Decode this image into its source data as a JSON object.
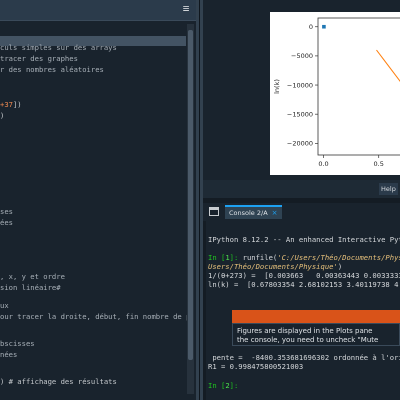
{
  "editor": {
    "lines": [
      {
        "text": "culs simples sur des arrays",
        "kind": "comment"
      },
      {
        "text": "tracer des graphes",
        "kind": "comment"
      },
      {
        "text": "r des nombres aléatoires",
        "kind": "comment"
      },
      {
        "text": ""
      },
      {
        "text": ""
      },
      {
        "pre": "",
        "num": "+37",
        "post": "])"
      },
      {
        "text": ")"
      },
      {
        "text": "ses",
        "kind": "comment"
      },
      {
        "text": "ées",
        "kind": "comment"
      },
      {
        "text": ", x, y et ordre",
        "kind": "comment"
      },
      {
        "text": "sion linéaire#",
        "kind": "comment"
      },
      {
        "text": "ux",
        "kind": "comment"
      },
      {
        "text": "our tracer la droite, début, fin nombre de p",
        "kind": "comment"
      },
      {
        "text": "bscisses",
        "kind": "comment"
      },
      {
        "text": "nées",
        "kind": "comment"
      },
      {
        "text": ") # affichage des résultats"
      }
    ]
  },
  "plot": {
    "ylabel": "ln(k)",
    "yticks": [
      "0",
      "−5000",
      "−10000",
      "−15000",
      "−20000"
    ],
    "xticks": [
      "0.0",
      "0.5"
    ],
    "colors": {
      "points": "#1f77b4",
      "fit": "#ff7f0e"
    }
  },
  "chart_data": {
    "type": "scatter",
    "title": "",
    "xlabel": "",
    "ylabel": "ln(k)",
    "xlim": [
      -0.05,
      0.72
    ],
    "ylim": [
      -22000,
      1500
    ],
    "series": [
      {
        "kind": "scatter",
        "x": [
          0.0036
        ],
        "y": [
          0.678
        ]
      },
      {
        "kind": "line",
        "x": [
          0.48,
          0.72
        ],
        "y": [
          -4000,
          -10000
        ]
      }
    ]
  },
  "pane": {
    "help_tab": "Help"
  },
  "console": {
    "tab_label": "Console 2/A",
    "close": "×",
    "banner": "IPython 8.12.2 -- An enhanced Interactive Pyt",
    "in1_prompt": "In [",
    "in1_num": "1",
    "in1_close": "]: ",
    "in1_cmd": "runfile(",
    "in1_arg1": "'C:/Users/Théo/Documents/Phys",
    "in1_arg2": "Users/Théo/Documents/Physique'",
    "in1_end": ")",
    "out1": "1/(θ+273) =  [0.003663   0.00363443 0.0033333",
    "out2": "ln(k) =  [0.67803354 2.68102153 3.40119738 4.",
    "popup_text1": "Figures are displayed in the Plots pane",
    "popup_text2": "the console, you need to uncheck \"Mute",
    "pente": " pente =  -8400.353681696302 ordonnée à l'ori",
    "r1": "R1 = 0.998475800521003",
    "in2_prompt": "In [",
    "in2_num": "2",
    "in2_close": "]: "
  }
}
